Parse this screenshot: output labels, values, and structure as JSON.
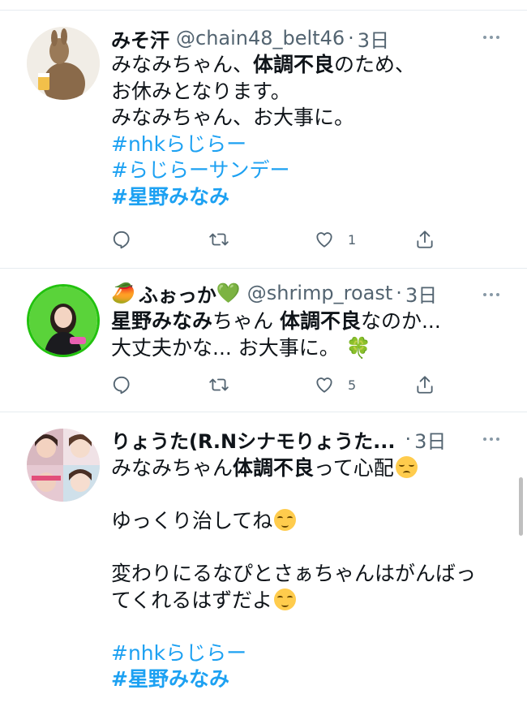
{
  "tweets": [
    {
      "name": "みそ汗",
      "handle": "@chain48_belt46",
      "sep": "·",
      "time": "3日",
      "lines": [
        [
          {
            "t": "みなみちゃん、"
          },
          {
            "t": "体調不良",
            "b": true
          },
          {
            "t": "のため、"
          }
        ],
        [
          {
            "t": "お休みとなります。"
          }
        ],
        [
          {
            "t": "みなみちゃん、お大事に。"
          }
        ]
      ],
      "hashtags": [
        "#nhkらじらー",
        "#らじらーサンデー",
        "#星野みなみ"
      ],
      "like_count": "1"
    },
    {
      "name_emoji_left": "🥭",
      "name": "ふぉっか",
      "name_emoji_right": "💚",
      "handle": "@shrimp_roast",
      "sep": "·",
      "time": "3日",
      "lines": [
        [
          {
            "t": "星野みなみ",
            "b": true
          },
          {
            "t": "ちゃん "
          },
          {
            "t": "体調不良",
            "b": true
          },
          {
            "t": "なのか..."
          }
        ],
        [
          {
            "t": "大丈夫かな... お大事に。 "
          },
          {
            "t": "🍀",
            "emoji": true
          }
        ]
      ],
      "like_count": "5"
    },
    {
      "name": "りょうた(R.Nシナモりょうた...",
      "handle": "",
      "sep": "·",
      "time": "3日",
      "body": [
        "みなみちゃん",
        "体調不良",
        "って心配",
        "ゆっくり治してね",
        "変わりにるなぴとさぁちゃんはがんばっ",
        "てくれるはずだよ"
      ],
      "hashtags": [
        "#nhkらじらー",
        "#星野みなみ"
      ]
    }
  ],
  "colors": {
    "link": "#1da1f2",
    "secondary": "#536471",
    "divider": "#e6ecf0"
  },
  "icons": [
    "reply-icon",
    "retweet-icon",
    "like-icon",
    "share-icon",
    "more-icon"
  ]
}
